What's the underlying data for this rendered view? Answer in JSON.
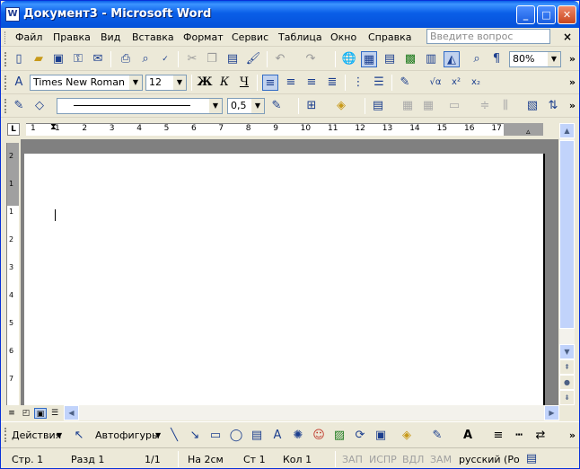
{
  "window": {
    "title": "Документ3 - Microsoft Word",
    "app_icon": "W"
  },
  "menu": {
    "items": [
      "Файл",
      "Правка",
      "Вид",
      "Вставка",
      "Формат",
      "Сервис",
      "Таблица",
      "Окно",
      "Справка"
    ],
    "ask_placeholder": "Введите вопрос",
    "close_glyph": "×"
  },
  "formatting": {
    "font": "Times New Roman",
    "size": "12",
    "zoom": "80%",
    "bold": "Ж",
    "italic": "К",
    "underline": "Ч",
    "formula": "√α",
    "superscript": "x²",
    "subscript": "x₂"
  },
  "tables_borders": {
    "line_weight": "0,5"
  },
  "ruler": {
    "numbers": [
      "1",
      "1",
      "2",
      "3",
      "4",
      "5",
      "6",
      "7",
      "8",
      "9",
      "10",
      "11",
      "12",
      "13",
      "14",
      "15",
      "16",
      "17"
    ],
    "vnumbers": [
      "2",
      "1",
      "1",
      "2",
      "3",
      "4",
      "5",
      "6",
      "7"
    ]
  },
  "drawing": {
    "actions": "Действия",
    "autoshapes": "Автофигуры"
  },
  "status": {
    "page": "Стр. 1",
    "section": "Разд 1",
    "pages": "1/1",
    "position": "На 2см",
    "line": "Ст 1",
    "column": "Кол 1",
    "rec": "ЗАП",
    "trk": "ИСПР",
    "ext": "ВДЛ",
    "ovr": "ЗАМ",
    "language": "русский (Ро"
  },
  "colors": {
    "title_bar": "#0a5ee8",
    "chrome": "#ece9d8",
    "workspace": "#808080",
    "active_button": "#c1d2ee"
  }
}
